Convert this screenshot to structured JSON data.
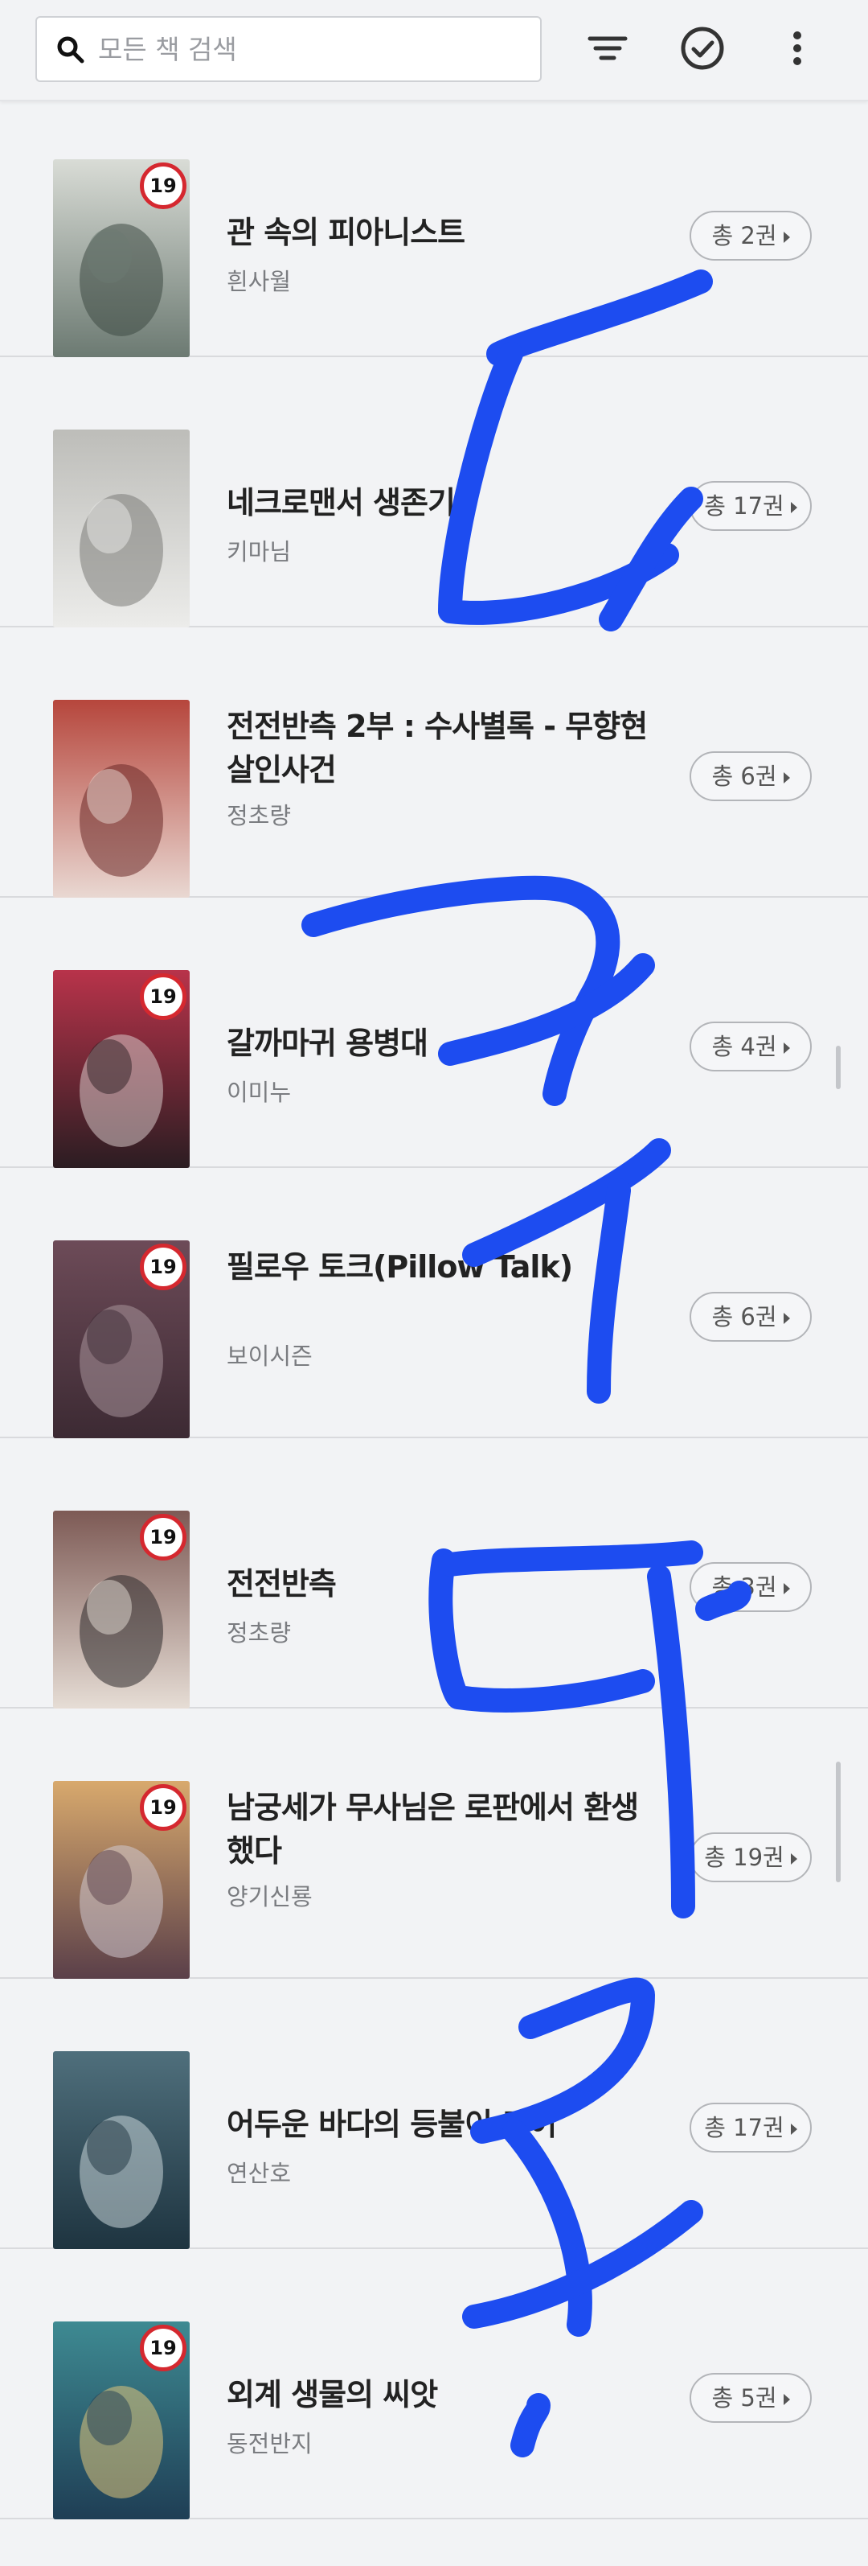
{
  "search": {
    "placeholder": "모든 책 검색"
  },
  "toolbar": {
    "icons": [
      "filter-icon",
      "check-circle-icon",
      "more-vertical-icon"
    ]
  },
  "badge_label": "19",
  "books": [
    {
      "title": "관 속의 피아니스트",
      "author": "흰사월",
      "count": "총 2권",
      "adult": true,
      "cover_colors": [
        "#6c7a72",
        "#d9dcd6",
        "#3e4a44"
      ]
    },
    {
      "title": "네크로맨서 생존기",
      "author": "키마님",
      "count": "총 17권",
      "adult": false,
      "cover_colors": [
        "#ececea",
        "#bdbdb9",
        "#7c7c78"
      ]
    },
    {
      "title": "전전반측 2부 : 수사별록 - 무향현 살인사건",
      "author": "정초량",
      "count": "총 6권",
      "adult": false,
      "cover_colors": [
        "#e9d8d2",
        "#b6463c",
        "#6b2a28"
      ]
    },
    {
      "title": "갈까마귀 용병대",
      "author": "이미누",
      "count": "총 4권",
      "adult": true,
      "cover_colors": [
        "#2b1d22",
        "#b8334a",
        "#d7c9c9"
      ]
    },
    {
      "title": "필로우 토크(Pillow Talk)",
      "author": "보이시즌",
      "count": "총 6권",
      "adult": true,
      "cover_colors": [
        "#3c2a33",
        "#6d4b58",
        "#a8949b"
      ]
    },
    {
      "title": "전전반측",
      "author": "정초량",
      "count": "총 3권",
      "adult": true,
      "cover_colors": [
        "#e6ddd5",
        "#7d5a55",
        "#2d2a2b"
      ]
    },
    {
      "title": "남궁세가 무사님은 로판에서 환생했다",
      "author": "양기신룡",
      "count": "총 19권",
      "adult": true,
      "cover_colors": [
        "#5a3f49",
        "#d8a96d",
        "#cfc8cf"
      ]
    },
    {
      "title": "어두운 바다의 등불이 되어",
      "author": "연산호",
      "count": "총 17권",
      "adult": false,
      "cover_colors": [
        "#1e3440",
        "#4f6f7c",
        "#c9d6d8"
      ]
    },
    {
      "title": "외계 생물의 씨앗",
      "author": "동전반지",
      "count": "총 5권",
      "adult": true,
      "cover_colors": [
        "#1f3e55",
        "#3e8a92",
        "#e0c57a"
      ]
    }
  ],
  "overlay": {
    "stroke_color": "#1d4cf0"
  }
}
